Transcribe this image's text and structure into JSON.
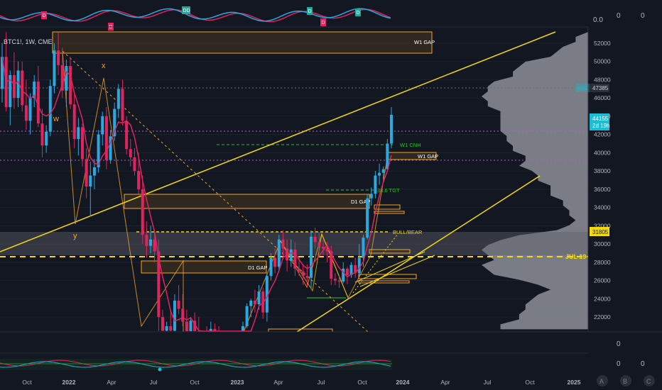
{
  "symbol": {
    "label": "BTC1!, 1W, CME"
  },
  "colors": {
    "background": "#131722",
    "up": "#29a9e0",
    "down": "#e0245e",
    "gap": "#f5a623",
    "trendline": "#f5d90a",
    "cnh": "#26c22e",
    "grid": "#1e222d",
    "axisText": "#b2b5be",
    "priceBadge": "#1cbcd3",
    "volumeProfile": "#8d8f96",
    "oscillatorA": "#e0245e",
    "oscillatorB": "#29a9e0"
  },
  "chart_data": {
    "type": "candlestick",
    "price_axis": {
      "min": 21000,
      "max": 53000,
      "ticks": [
        22000,
        24000,
        26000,
        28000,
        30000,
        32000,
        34000,
        36000,
        38000,
        40000,
        42000,
        44000,
        46000,
        48000,
        50000,
        52000
      ],
      "tick_labels": [
        "22000",
        "24000",
        "26000",
        "28000",
        "30000",
        "32000",
        "34000",
        "36000",
        "38000",
        "40000",
        "42000",
        "44000",
        "46000",
        "48000",
        "50000",
        "52000"
      ]
    },
    "time_axis": {
      "labels": [
        "Oct",
        "2022",
        "Apr",
        "Jul",
        "Oct",
        "2023",
        "Apr",
        "Jul",
        "Oct",
        "2024",
        "Apr",
        "Jul",
        "Oct",
        "2025"
      ],
      "bold": [
        false,
        true,
        false,
        false,
        false,
        true,
        false,
        false,
        false,
        true,
        false,
        false,
        false,
        true
      ]
    },
    "candles": [
      [
        47000,
        52000,
        45500,
        50500
      ],
      [
        50500,
        53200,
        44500,
        45000
      ],
      [
        45000,
        49000,
        43000,
        48500
      ],
      [
        48500,
        51000,
        44800,
        46000
      ],
      [
        46000,
        50000,
        45000,
        49000
      ],
      [
        49000,
        50000,
        44500,
        45200
      ],
      [
        45200,
        48000,
        42500,
        43500
      ],
      [
        43500,
        46500,
        42000,
        46000
      ],
      [
        46000,
        48500,
        45000,
        47800
      ],
      [
        47800,
        49500,
        42800,
        43200
      ],
      [
        43200,
        44800,
        39500,
        40800
      ],
      [
        40800,
        43000,
        40000,
        42300
      ],
      [
        42300,
        48000,
        41800,
        47300
      ],
      [
        47300,
        52000,
        46500,
        51200
      ],
      [
        51200,
        53200,
        48500,
        49600
      ],
      [
        49600,
        51500,
        46000,
        46800
      ],
      [
        46800,
        50200,
        45000,
        49500
      ],
      [
        49500,
        50500,
        44800,
        45300
      ],
      [
        45300,
        46500,
        40500,
        41500
      ],
      [
        41500,
        43800,
        39700,
        42800
      ],
      [
        42800,
        43200,
        38500,
        39300
      ],
      [
        39300,
        40500,
        35000,
        36300
      ],
      [
        36300,
        39000,
        33000,
        37500
      ],
      [
        37500,
        39300,
        36000,
        38400
      ],
      [
        38400,
        42500,
        37800,
        42000
      ],
      [
        42000,
        44500,
        40800,
        44000
      ],
      [
        44000,
        45000,
        38200,
        39200
      ],
      [
        39200,
        42500,
        38800,
        41800
      ],
      [
        41800,
        45500,
        41300,
        44800
      ],
      [
        44800,
        47500,
        43800,
        47000
      ],
      [
        47000,
        48000,
        43000,
        43500
      ],
      [
        43500,
        44000,
        39800,
        40400
      ],
      [
        40400,
        41500,
        38500,
        39500
      ],
      [
        39500,
        40500,
        37500,
        38000
      ],
      [
        38000,
        40000,
        35500,
        36000
      ],
      [
        36000,
        37500,
        30000,
        31000
      ],
      [
        31000,
        32500,
        28500,
        29800
      ],
      [
        29800,
        32000,
        29000,
        30500
      ],
      [
        30500,
        31500,
        28000,
        29200
      ],
      [
        29200,
        30500,
        20500,
        22000
      ],
      [
        22000,
        22800,
        17500,
        20500
      ],
      [
        20500,
        21500,
        18500,
        21000
      ],
      [
        21000,
        22800,
        19800,
        20500
      ],
      [
        20500,
        24500,
        20000,
        23800
      ],
      [
        23800,
        25500,
        22300,
        22900
      ],
      [
        22900,
        24500,
        21000,
        21500
      ],
      [
        21500,
        22800,
        19500,
        19800
      ],
      [
        19800,
        22000,
        18800,
        21600
      ],
      [
        21600,
        22500,
        19800,
        20300
      ],
      [
        20300,
        22000,
        19000,
        19400
      ],
      [
        19400,
        20500,
        18500,
        20000
      ],
      [
        20000,
        21000,
        19000,
        19700
      ],
      [
        19700,
        21500,
        19300,
        20700
      ],
      [
        20700,
        21300,
        20000,
        20300
      ],
      [
        20300,
        21000,
        16000,
        16800
      ],
      [
        16800,
        17800,
        15500,
        17000
      ],
      [
        17000,
        17500,
        16500,
        17200
      ],
      [
        17200,
        17800,
        16700,
        16900
      ],
      [
        16900,
        17500,
        16300,
        16700
      ],
      [
        16700,
        17200,
        16500,
        16900
      ],
      [
        16900,
        21500,
        16800,
        21000
      ],
      [
        21000,
        23500,
        20800,
        23200
      ],
      [
        23200,
        24000,
        22000,
        23800
      ],
      [
        23800,
        25000,
        22500,
        23400
      ],
      [
        23400,
        25500,
        22800,
        24800
      ],
      [
        24800,
        25200,
        21800,
        22500
      ],
      [
        22500,
        26800,
        21500,
        26500
      ],
      [
        26500,
        29000,
        26000,
        28500
      ],
      [
        28500,
        29500,
        26800,
        27500
      ],
      [
        27500,
        31000,
        27000,
        30500
      ],
      [
        30500,
        31500,
        28500,
        29500
      ],
      [
        29500,
        30500,
        27000,
        28200
      ],
      [
        28200,
        30500,
        27500,
        29400
      ],
      [
        29400,
        30200,
        26500,
        27300
      ],
      [
        27300,
        28500,
        26500,
        27000
      ],
      [
        27000,
        27800,
        25500,
        26500
      ],
      [
        26500,
        27800,
        25200,
        26300
      ],
      [
        26300,
        31500,
        25200,
        30800
      ],
      [
        30800,
        31800,
        29500,
        30200
      ],
      [
        30200,
        31200,
        29000,
        29700
      ],
      [
        29700,
        30500,
        28800,
        29500
      ],
      [
        29500,
        30200,
        28000,
        29200
      ],
      [
        29200,
        29800,
        25500,
        26200
      ],
      [
        26200,
        26800,
        25500,
        26000
      ],
      [
        26000,
        26500,
        25200,
        25900
      ],
      [
        25900,
        28000,
        25700,
        27300
      ],
      [
        27300,
        27500,
        25600,
        26600
      ],
      [
        26600,
        28000,
        26300,
        27700
      ],
      [
        27700,
        28500,
        26300,
        26800
      ],
      [
        26800,
        30000,
        26500,
        28500
      ],
      [
        28500,
        31000,
        27500,
        30700
      ],
      [
        30700,
        35500,
        30500,
        35000
      ],
      [
        35000,
        36200,
        34200,
        35500
      ],
      [
        35500,
        38000,
        35000,
        37500
      ],
      [
        37500,
        38800,
        36500,
        37800
      ],
      [
        37800,
        38500,
        36800,
        38200
      ],
      [
        38200,
        41500,
        38000,
        41000
      ],
      [
        41000,
        45000,
        40500,
        44155
      ]
    ],
    "annotations": [
      {
        "text": "W1 GAP"
      },
      {
        "text": "D1 GAP"
      },
      {
        "text": "D1 GAP"
      },
      {
        "text": "W1 GAP"
      },
      {
        "text": "W1 CNH"
      },
      {
        "text": "BULL/BEAR"
      },
      {
        "text": "38.6 TGT"
      },
      {
        "text": "x"
      },
      {
        "text": "w"
      },
      {
        "text": "y"
      },
      {
        "text": "A"
      },
      {
        "text": "B"
      },
      {
        "text": "C"
      }
    ],
    "price_badges": [
      {
        "text": "MVN",
        "value": 47385,
        "label": "47385"
      },
      {
        "text": "",
        "value": 44155,
        "label": "44155"
      },
      {
        "text": "",
        "value": 43000,
        "label": "2d 19h"
      },
      {
        "text": "",
        "value": 31805,
        "label": "31805"
      },
      {
        "text": "JUL 19",
        "value": 29200,
        "label": "JUL 19"
      }
    ],
    "top_indicator": {
      "value_label": "0.0",
      "extra": [
        "0",
        "0"
      ],
      "markers": [
        "D",
        "D",
        "DD",
        "D",
        "D",
        "D"
      ]
    },
    "bottom_indicator": {
      "values": [
        "0",
        "0",
        "0"
      ]
    },
    "footer_buttons": [
      "A",
      "B",
      "C"
    ]
  }
}
